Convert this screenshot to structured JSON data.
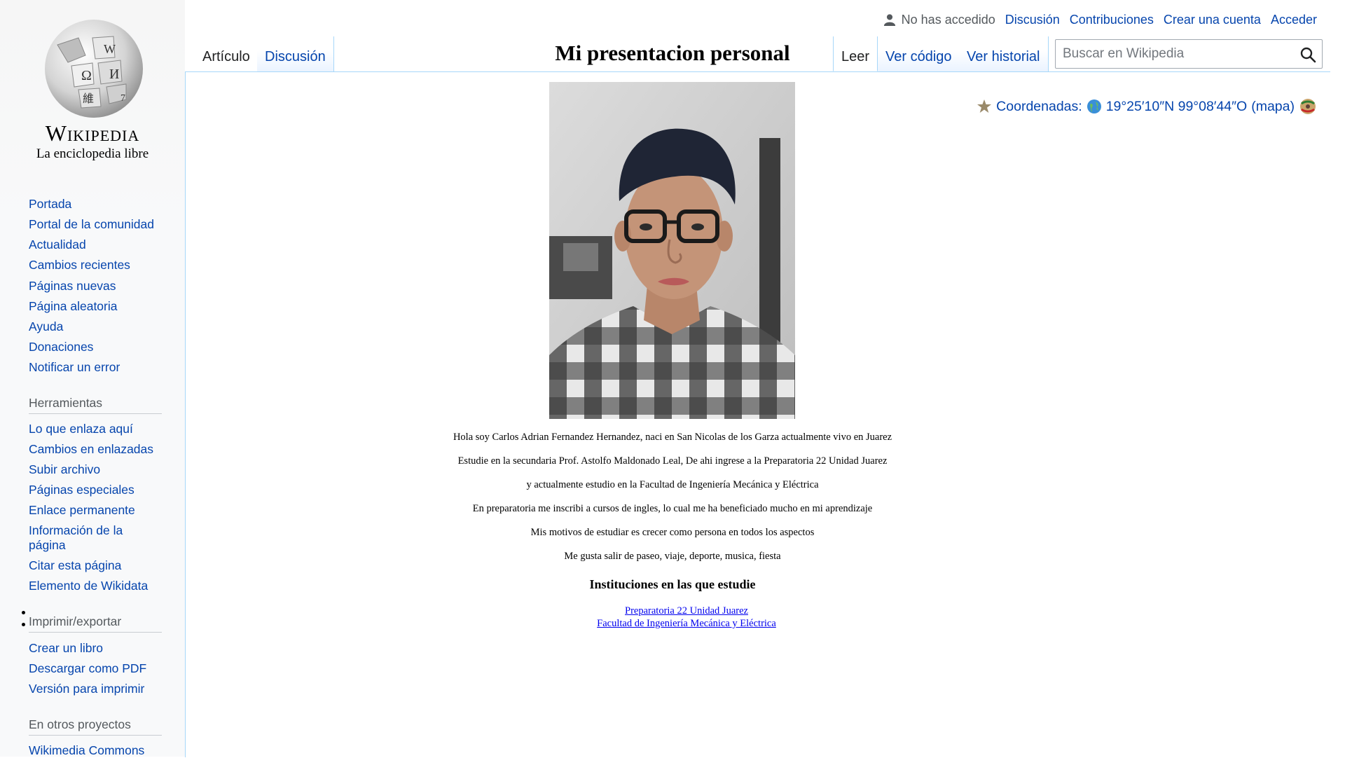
{
  "logo": {
    "wordmark": "Wikipedia",
    "tagline": "La enciclopedia libre"
  },
  "sidebar": {
    "navigation": [
      "Portada",
      "Portal de la comunidad",
      "Actualidad",
      "Cambios recientes",
      "Páginas nuevas",
      "Página aleatoria",
      "Ayuda",
      "Donaciones",
      "Notificar un error"
    ],
    "tools_heading": "Herramientas",
    "tools": [
      "Lo que enlaza aquí",
      "Cambios en enlazadas",
      "Subir archivo",
      "Páginas especiales",
      "Enlace permanente",
      "Información de la página",
      "Citar esta página",
      "Elemento de Wikidata"
    ],
    "print_heading": "Imprimir/exportar",
    "print": [
      "Crear un libro",
      "Descargar como PDF",
      "Versión para imprimir"
    ],
    "projects_heading": "En otros proyectos",
    "projects": [
      "Wikimedia Commons"
    ]
  },
  "personal": {
    "status": "No has accedido",
    "links": [
      "Discusión",
      "Contribuciones",
      "Crear una cuenta",
      "Acceder"
    ]
  },
  "tabs": {
    "left": [
      "Artículo",
      "Discusión"
    ],
    "right": [
      "Leer",
      "Ver código",
      "Ver historial"
    ]
  },
  "search": {
    "placeholder": "Buscar en Wikipedia"
  },
  "page": {
    "title": "Mi presentacion personal"
  },
  "coordinates": {
    "label": "Coordenadas:",
    "value": "19°25′10″N 99°08′44″O",
    "map": "(mapa)"
  },
  "article": {
    "paragraphs": [
      "Hola soy Carlos Adrian Fernandez Hernandez, naci en San Nicolas de los Garza actualmente vivo en Juarez",
      "Estudie en la secundaria Prof. Astolfo Maldonado Leal, De ahi ingrese a la Preparatoria 22 Unidad Juarez",
      "y actualmente estudio en la Facultad de Ingeniería Mecánica y Eléctrica",
      "En preparatoria me inscribi a cursos de ingles, lo cual me ha beneficiado mucho en mi aprendizaje",
      "Mis motivos de estudiar es crecer como persona en todos los aspectos",
      "Me gusta salir de paseo, viaje, deporte, musica, fiesta"
    ],
    "institutions_heading": "Instituciones en las que estudie",
    "institutions": [
      "Preparatoria 22 Unidad Juarez",
      "Facultad de Ingeniería Mecánica y Eléctrica"
    ]
  },
  "colors": {
    "link": "#0645ad",
    "tab_border": "#a7d7f9",
    "sidebar_bg": "#f8f9fa"
  },
  "icons": [
    "user-icon",
    "search-icon",
    "star-icon",
    "globe-icon",
    "flag-icon",
    "wikipedia-globe-logo"
  ]
}
